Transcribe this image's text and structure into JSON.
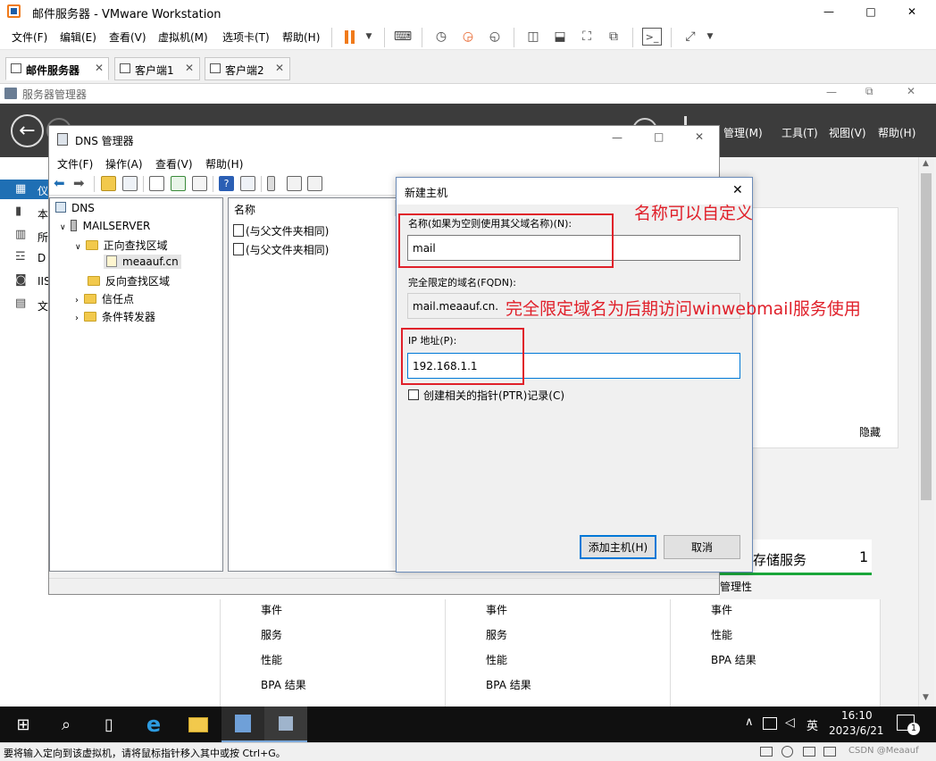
{
  "vmware": {
    "title": "邮件服务器 - VMware Workstation",
    "menu": [
      "文件(F)",
      "编辑(E)",
      "查看(V)",
      "虚拟机(M)",
      "选项卡(T)",
      "帮助(H)"
    ],
    "tabs": [
      {
        "label": "邮件服务器",
        "active": true
      },
      {
        "label": "客户端1",
        "active": false
      },
      {
        "label": "客户端2",
        "active": false
      }
    ],
    "status_text": "要将输入定向到该虚拟机，请将鼠标指针移入其中或按 Ctrl+G。",
    "watermark": "CSDN @Meaauf"
  },
  "server_manager": {
    "title": "服务器管理器",
    "header_menu": [
      "管理(M)",
      "工具(T)",
      "视图(V)",
      "帮助(H)"
    ],
    "nav_prefix": [
      "仪",
      "本",
      "所",
      "D",
      "IIS",
      "文"
    ],
    "hide_label": "隐藏",
    "storage_tile": {
      "title": "存储服务",
      "count": "1",
      "subline": "管理性"
    },
    "tile_items": [
      [
        "事件",
        "服务",
        "性能",
        "BPA 结果"
      ],
      [
        "事件",
        "服务",
        "性能",
        "BPA 结果"
      ],
      [
        "事件",
        "性能",
        "BPA 结果"
      ]
    ]
  },
  "dns_manager": {
    "title": "DNS 管理器",
    "menu": [
      "文件(F)",
      "操作(A)",
      "查看(V)",
      "帮助(H)"
    ],
    "tree": {
      "root": "DNS",
      "server": "MAILSERVER",
      "forward_zones": "正向查找区域",
      "zone": "meaauf.cn",
      "reverse_zones": "反向查找区域",
      "trust_points": "信任点",
      "conditional_forwarders": "条件转发器"
    },
    "list_header": "名称",
    "list_items": [
      "(与父文件夹相同)",
      "(与父文件夹相同)"
    ]
  },
  "dialog": {
    "title": "新建主机",
    "name_label": "名称(如果为空则使用其父域名称)(N):",
    "name_value": "mail",
    "fqdn_label": "完全限定的域名(FQDN):",
    "fqdn_value": "mail.meaauf.cn.",
    "ip_label": "IP 地址(P):",
    "ip_value": "192.168.1.1",
    "ptr_label": "创建相关的指针(PTR)记录(C)",
    "ptr_checked": false,
    "add_button": "添加主机(H)",
    "cancel_button": "取消"
  },
  "annotations": {
    "name_note": "名称可以自定义",
    "fqdn_note": "完全限定域名为后期访问winwebmail服务使用"
  },
  "taskbar": {
    "lang": "英",
    "time": "16:10",
    "date": "2023/6/21",
    "notification_count": "1"
  },
  "colors": {
    "annotation_red": "#e0202a",
    "vmware_pause_orange": "#f07a1a",
    "server_manager_header": "#3c3c3c",
    "storage_accent": "#1aa63a",
    "taskbar": "#101010"
  }
}
